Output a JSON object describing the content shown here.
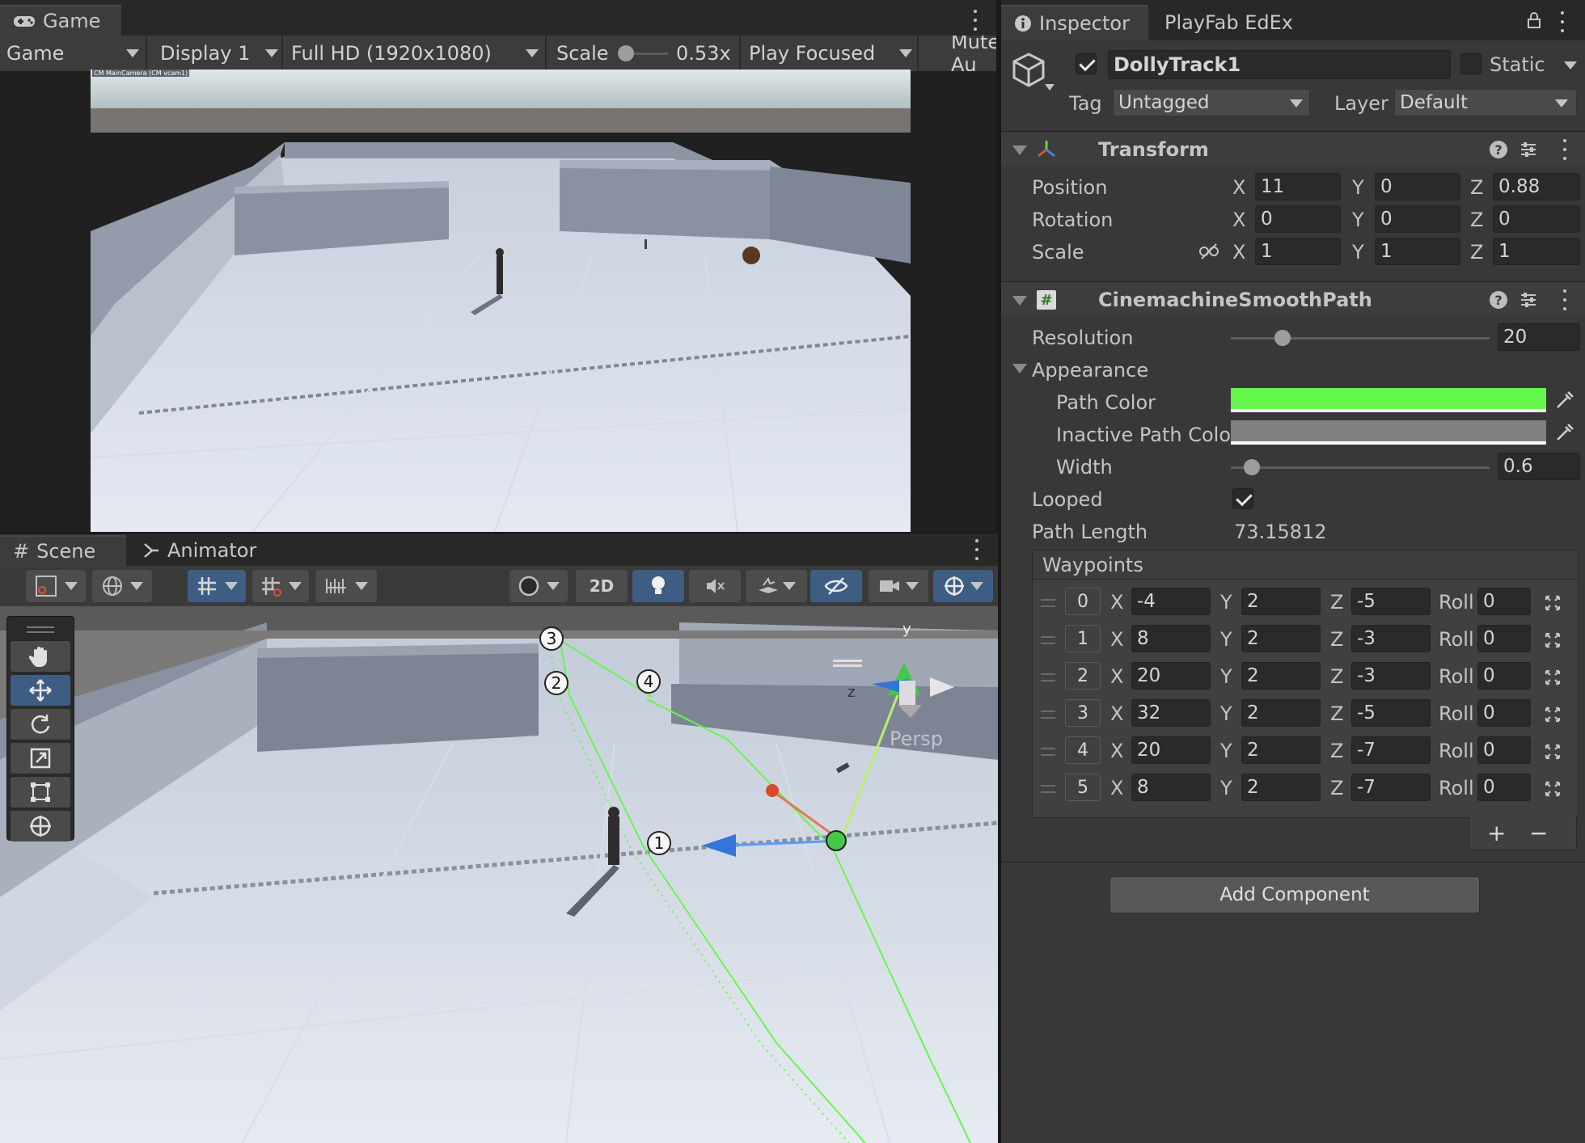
{
  "game": {
    "tab_label": "Game",
    "mode_value": "Game",
    "display_value": "Display 1",
    "resolution_value": "Full HD (1920x1080)",
    "scale_label": "Scale",
    "scale_value": "0.53x",
    "scale_fraction": 0.15,
    "play_mode_value": "Play Focused",
    "mute_label": "Mute Au",
    "camera_overlay_text": "CM MainCamera (CM vcam1)"
  },
  "scene": {
    "tab_label": "Scene",
    "animator_tab_label": "Animator",
    "toggle_2d_label": "2D",
    "persp_label": "Persp",
    "gizmo_axis_y": "y",
    "gizmo_axis_z": "z",
    "waypoint_markers": [
      "1",
      "2",
      "3",
      "4"
    ]
  },
  "tools": [
    "hand-tool",
    "move-tool",
    "rotate-tool",
    "scale-tool",
    "rect-tool",
    "transform-tool"
  ],
  "inspector": {
    "tab_label": "Inspector",
    "playfab_tab_label": "PlayFab EdEx",
    "object_name": "DollyTrack1",
    "static_label": "Static",
    "tag_label": "Tag",
    "tag_value": "Untagged",
    "layer_label": "Layer",
    "layer_value": "Default"
  },
  "transform": {
    "title": "Transform",
    "position_label": "Position",
    "rotation_label": "Rotation",
    "scale_label": "Scale",
    "axis_x": "X",
    "axis_y": "Y",
    "axis_z": "Z",
    "position": {
      "x": "11",
      "y": "0",
      "z": "0.88"
    },
    "rotation": {
      "x": "0",
      "y": "0",
      "z": "0"
    },
    "scale": {
      "x": "1",
      "y": "1",
      "z": "1"
    }
  },
  "smooth_path": {
    "title": "CinemachineSmoothPath",
    "resolution_label": "Resolution",
    "resolution_value": "20",
    "resolution_fraction": 0.2,
    "appearance_label": "Appearance",
    "path_color_label": "Path Color",
    "path_color": "#66f74c",
    "inactive_color_label": "Inactive Path Color",
    "inactive_color": "#808080",
    "width_label": "Width",
    "width_value": "0.6",
    "width_fraction": 0.08,
    "looped_label": "Looped",
    "path_length_label": "Path Length",
    "path_length_value": "73.15812",
    "waypoints_label": "Waypoints",
    "roll_label": "Roll",
    "waypoints": [
      {
        "index": "0",
        "x": "-4",
        "y": "2",
        "z": "-5",
        "roll": "0"
      },
      {
        "index": "1",
        "x": "8",
        "y": "2",
        "z": "-3",
        "roll": "0"
      },
      {
        "index": "2",
        "x": "20",
        "y": "2",
        "z": "-3",
        "roll": "0"
      },
      {
        "index": "3",
        "x": "32",
        "y": "2",
        "z": "-5",
        "roll": "0"
      },
      {
        "index": "4",
        "x": "20",
        "y": "2",
        "z": "-7",
        "roll": "0"
      },
      {
        "index": "5",
        "x": "8",
        "y": "2",
        "z": "-7",
        "roll": "0"
      }
    ],
    "add_symbol": "+",
    "remove_symbol": "−"
  },
  "add_component_label": "Add Component"
}
